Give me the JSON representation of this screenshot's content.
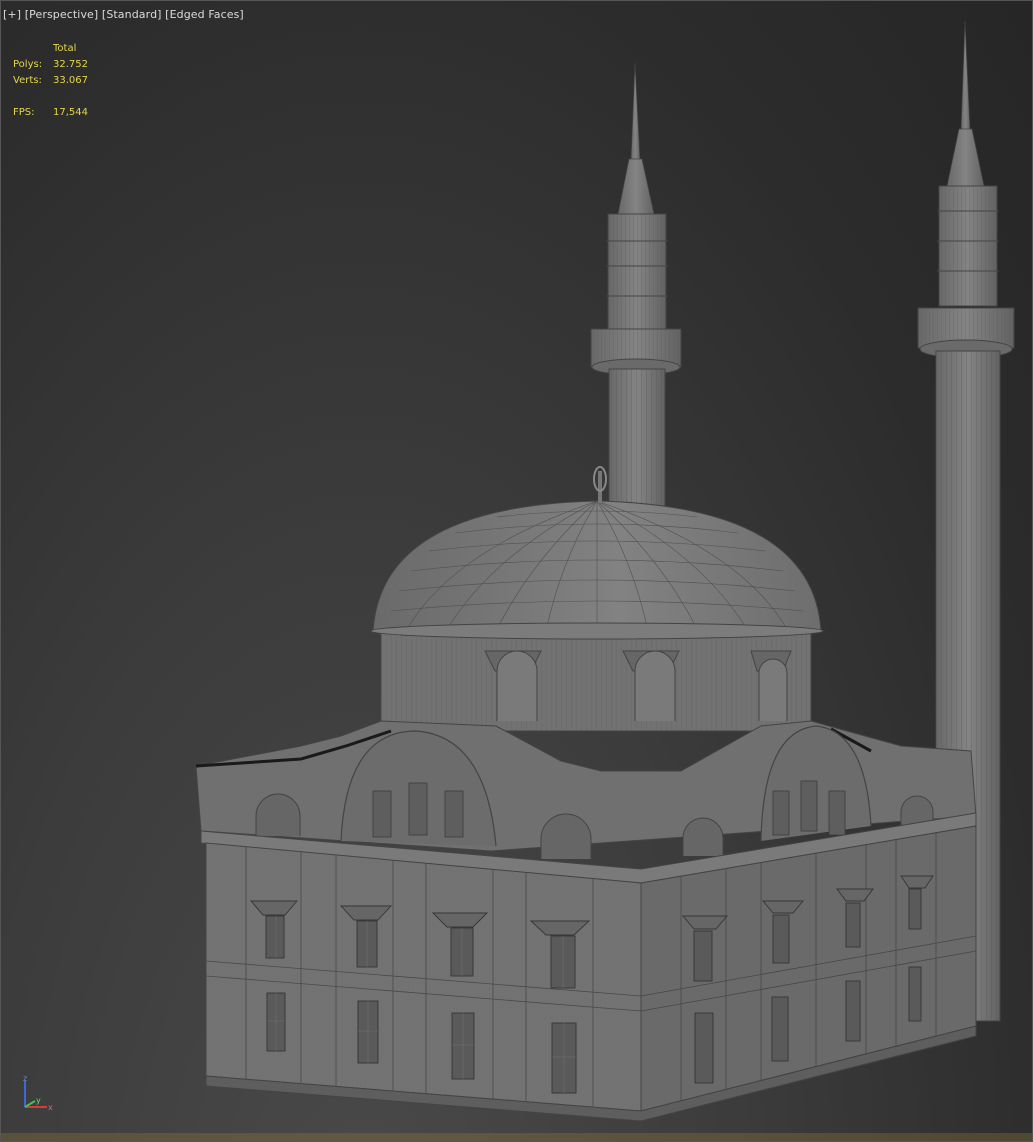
{
  "viewport": {
    "labels": [
      "[+]",
      "[Perspective]",
      "[Standard]",
      "[Edged Faces]"
    ]
  },
  "stats": {
    "header": "Total",
    "polys_label": "Polys:",
    "polys_value": "32.752",
    "verts_label": "Verts:",
    "verts_value": "33.067",
    "fps_label": "FPS:",
    "fps_value": "17,544"
  },
  "axis": {
    "z": "z",
    "x": "x",
    "y": "y"
  },
  "colors": {
    "stats_text": "#e4d64a",
    "model_fill": "#747474",
    "wire": "#3a3a3a"
  }
}
